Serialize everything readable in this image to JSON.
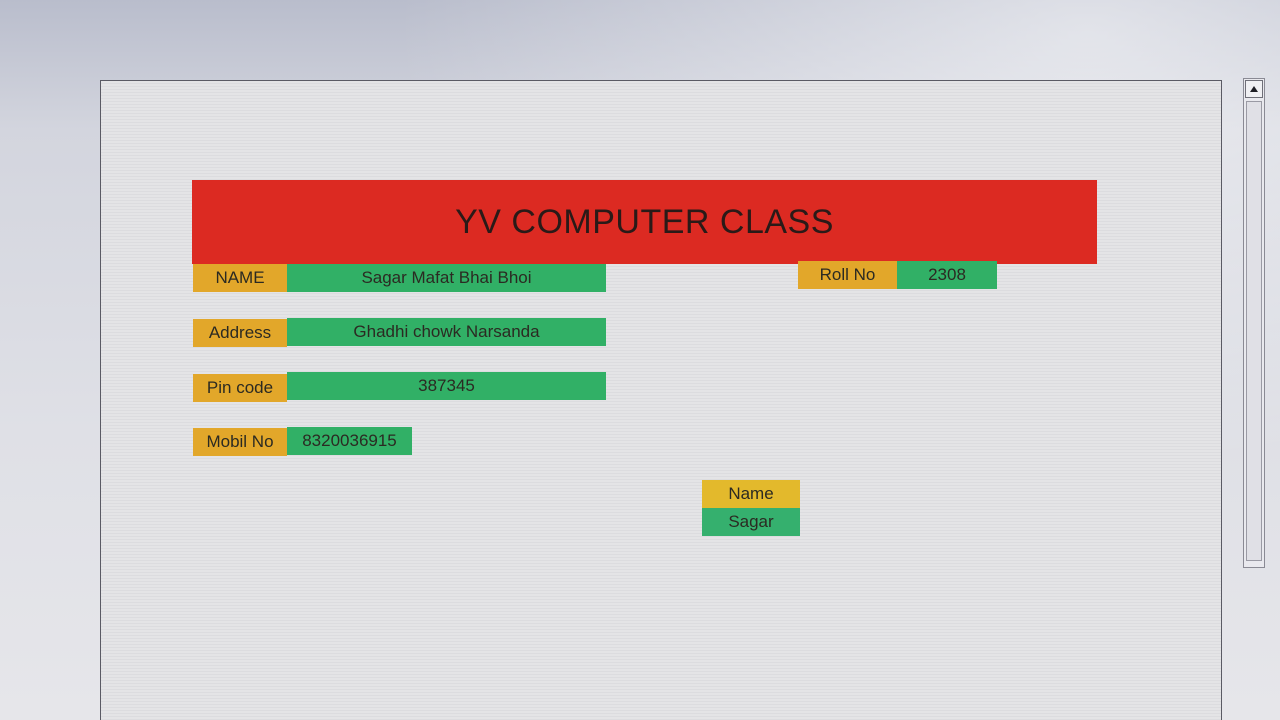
{
  "banner": {
    "title": "YV COMPUTER CLASS"
  },
  "form": {
    "name": {
      "label": "NAME",
      "value": "Sagar Mafat Bhai Bhoi"
    },
    "roll": {
      "label": "Roll No",
      "value": "2308"
    },
    "address": {
      "label": "Address",
      "value": "Ghadhi chowk Narsanda"
    },
    "pin": {
      "label": "Pin code",
      "value": "387345"
    },
    "mobile": {
      "label": "Mobil No",
      "value": "8320036915"
    }
  },
  "lookup": {
    "label": "Name",
    "value": "Sagar"
  },
  "icons": {
    "scroll_up": "arrow-up-icon"
  },
  "colors": {
    "banner": "#dc2a22",
    "label_cells": "#e2a72a",
    "value_cells": "#31b066"
  }
}
